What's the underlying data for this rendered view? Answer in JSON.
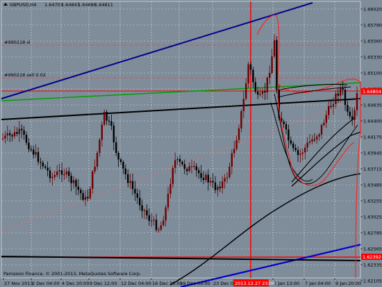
{
  "header": {
    "symbol": "GBPUSD,H4",
    "open": "1.64703",
    "high": "1.64847",
    "low": "1.64686",
    "close": "1.64811"
  },
  "order_labels": [
    {
      "text": "#990218 sl"
    },
    {
      "text": "#990218 sell 0.02"
    }
  ],
  "copyright": "Pamsoon Finance, © 2001-2013, MetaQuotes Software Corp.",
  "price_labels": [
    "1.66020",
    "1.65790",
    "1.65560",
    "1.65330",
    "1.65100",
    "1.64870",
    "1.64635",
    "1.64400",
    "1.64175",
    "1.63945",
    "1.63715",
    "1.63485",
    "1.63255",
    "1.63025",
    "1.62795",
    "1.62565",
    "1.62335",
    "1.62105"
  ],
  "price_tags": {
    "bid": "1.64804",
    "bottom": "1.62392"
  },
  "time_labels": [
    "27 Nov 2013",
    "2 Dec 04:00",
    "4 Dec 20:00",
    "9 Dec 12:00",
    "12 Dec 04:00",
    "16 Dec 20:00",
    "19 Dec 09:00",
    "23 Dec 0",
    "2 Jan 13:00",
    "7 Jan 04:00",
    "9 Jan 20:00"
  ],
  "time_tag": "2013.12.27 23:00",
  "colors": {
    "background": "#7f8c99",
    "grid": "#d0d6dc",
    "bull": "#7a0000",
    "bear": "#000000",
    "red": "#ff0000",
    "blue": "#00008b",
    "green": "#00a000"
  }
}
